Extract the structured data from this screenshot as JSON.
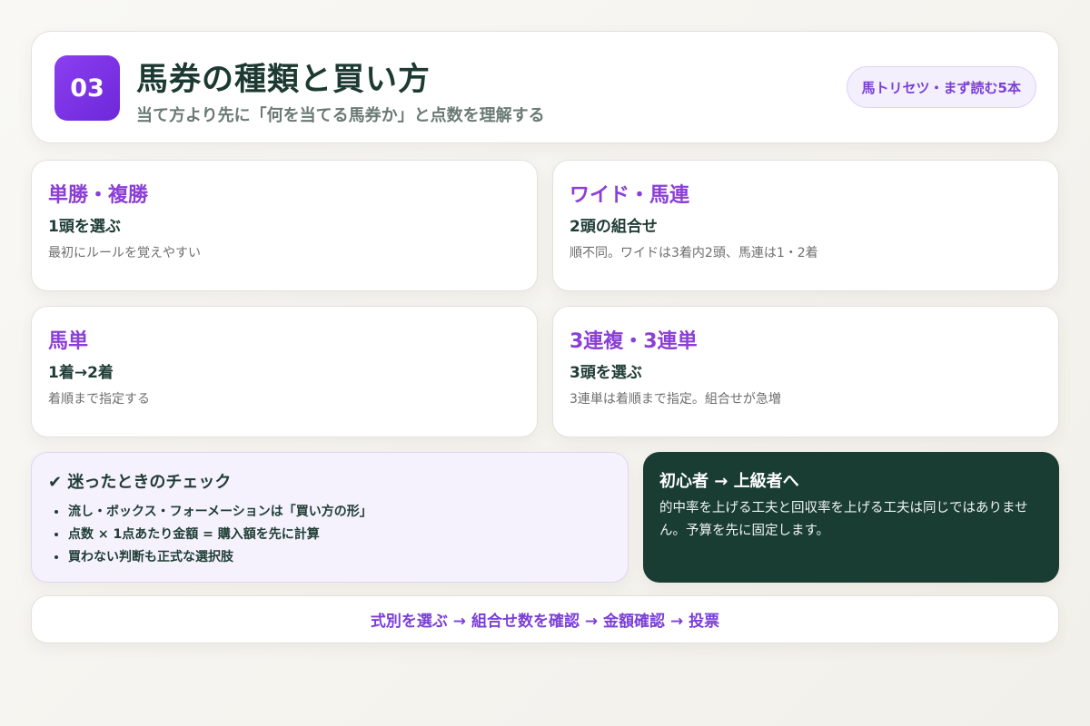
{
  "header": {
    "number": "03",
    "title": "馬券の種類と買い方",
    "subtitle": "当て方より先に「何を当てる馬券か」と点数を理解する",
    "series_label": "馬トリセツ・まず読む5本"
  },
  "cards": [
    {
      "title": "単勝・複勝",
      "sub": "1頭を選ぶ",
      "desc": "最初にルールを覚えやすい"
    },
    {
      "title": "ワイド・馬連",
      "sub": "2頭の組合せ",
      "desc": "順不同。ワイドは3着内2頭、馬連は1・2着"
    },
    {
      "title": "馬単",
      "sub": "1着→2着",
      "desc": "着順まで指定する"
    },
    {
      "title": "3連複・3連単",
      "sub": "3頭を選ぶ",
      "desc": "3連単は着順まで指定。組合せが急増"
    }
  ],
  "checklist": {
    "title": "✔ 迷ったときのチェック",
    "items": [
      "流し・ボックス・フォーメーションは「買い方の形」",
      "点数 × 1点あたり金額 = 購入額を先に計算",
      "買わない判断も正式な選択肢"
    ]
  },
  "note": {
    "title": "初心者 → 上級者へ",
    "body": "的中率を上げる工夫と回収率を上げる工夫は同じではありません。予算を先に固定します。"
  },
  "flow": {
    "text": "式別を選ぶ → 組合せ数を確認 → 金額確認 → 投票"
  },
  "colors": {
    "accent_purple": "#7a3fd6",
    "dark_green": "#1a3d33",
    "badge_gradient_start": "#8b3ff0",
    "badge_gradient_end": "#6d28d9"
  }
}
